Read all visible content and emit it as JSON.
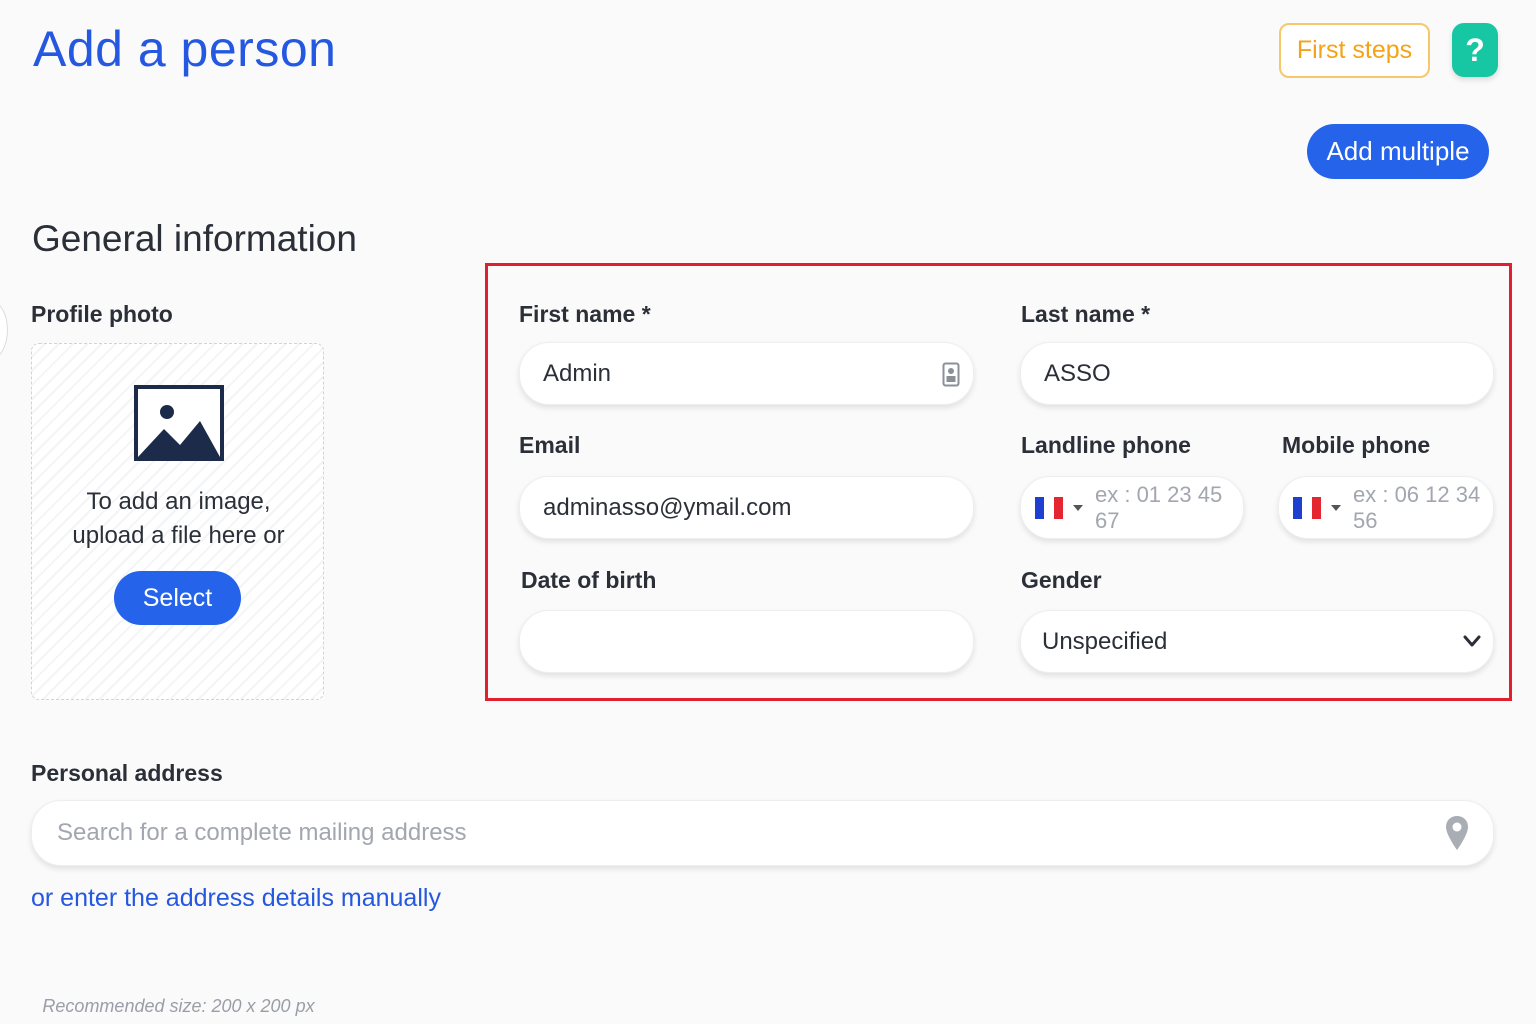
{
  "header": {
    "title": "Add a person",
    "first_steps_label": "First steps",
    "help_label": "?",
    "add_multiple_label": "Add multiple"
  },
  "general": {
    "title": "General information",
    "profile_photo": {
      "label": "Profile photo",
      "text_line1": "To add an image,",
      "text_line2": "upload a file here or",
      "select_label": "Select",
      "recommended": "Recommended size: 200 x 200 px"
    },
    "first_name": {
      "label": "First name *",
      "value": "Admin"
    },
    "last_name": {
      "label": "Last name *",
      "value": "ASSO"
    },
    "email": {
      "label": "Email",
      "value": "adminasso@ymail.com"
    },
    "landline": {
      "label": "Landline phone",
      "placeholder": "ex : 01 23 45 67"
    },
    "mobile": {
      "label": "Mobile phone",
      "placeholder": "ex : 06 12 34 56"
    },
    "date_of_birth": {
      "label": "Date of birth",
      "value": ""
    },
    "gender": {
      "label": "Gender",
      "value": "Unspecified"
    }
  },
  "address": {
    "label": "Personal address",
    "placeholder": "Search for a complete mailing address",
    "manual_link": "or enter the address details manually"
  },
  "colors": {
    "primary": "#2563eb",
    "title": "#2458e0",
    "first_steps": "#f5a316",
    "help": "#17c7a4",
    "highlight": "#e0202e"
  }
}
